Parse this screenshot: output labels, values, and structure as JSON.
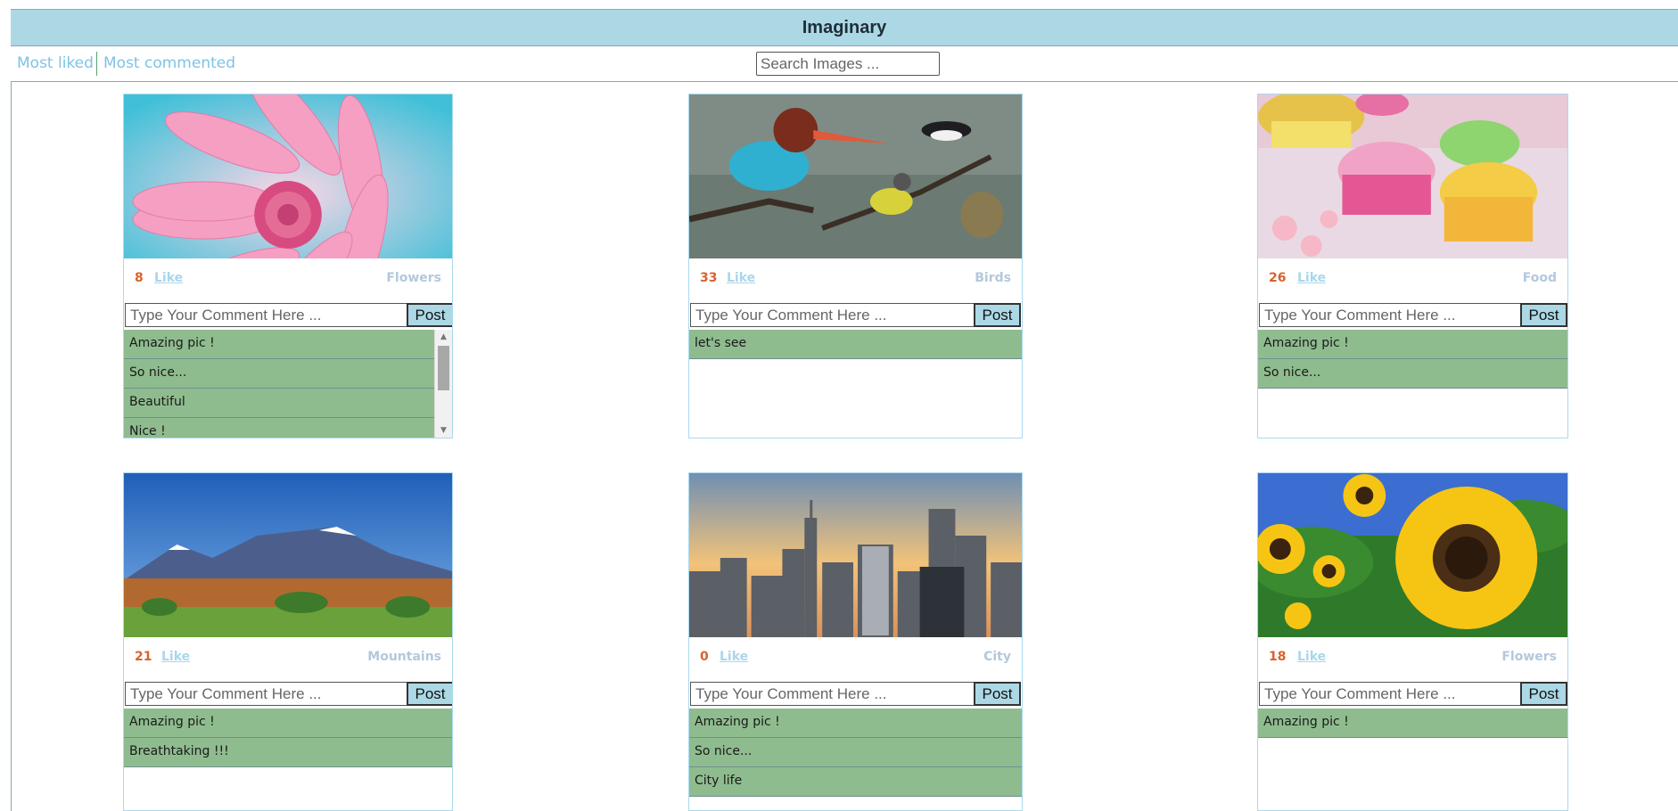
{
  "app": {
    "title": "Imaginary"
  },
  "nav": {
    "most_liked": "Most liked",
    "most_commented": "Most commented",
    "search_placeholder": "Search Images ..."
  },
  "card_labels": {
    "like": "Like",
    "comment_placeholder": "Type Your Comment Here ...",
    "post": "Post"
  },
  "cards": [
    {
      "likes": "8",
      "category": "Flowers",
      "image": "pink-daisy-flower",
      "comments": [
        "Amazing pic !",
        "So nice...",
        "Beautiful",
        "Nice !"
      ]
    },
    {
      "likes": "33",
      "category": "Birds",
      "image": "birds-on-branch",
      "comments": [
        "let's see"
      ]
    },
    {
      "likes": "26",
      "category": "Food",
      "image": "cupcakes",
      "comments": [
        "Amazing pic !",
        "So nice..."
      ]
    },
    {
      "likes": "21",
      "category": "Mountains",
      "image": "mountain-landscape",
      "comments": [
        "Amazing pic !",
        "Breathtaking !!!"
      ]
    },
    {
      "likes": "0",
      "category": "City",
      "image": "city-skyline",
      "comments": [
        "Amazing pic !",
        "So nice...",
        "City life"
      ]
    },
    {
      "likes": "18",
      "category": "Flowers",
      "image": "sunflowers",
      "comments": [
        "Amazing pic !"
      ]
    }
  ],
  "colors": {
    "header_bg": "#acd8e6",
    "link": "#7ec3e6",
    "likes_count": "#d9622b",
    "comment_bg": "#8fbc8f"
  }
}
